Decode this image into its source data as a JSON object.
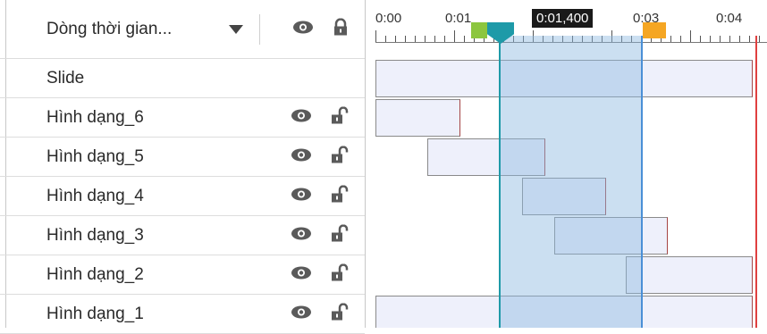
{
  "header": {
    "title": "Dòng thời gian...",
    "icons": [
      "eye-icon",
      "lock-closed-icon"
    ]
  },
  "rows": [
    {
      "label": "Slide",
      "visible_icon": "",
      "lock_icon": ""
    },
    {
      "label": "Hình dạng_6",
      "visible_icon": "eye-icon",
      "lock_icon": "lock-open-icon"
    },
    {
      "label": "Hình dạng_5",
      "visible_icon": "eye-icon",
      "lock_icon": "lock-open-icon"
    },
    {
      "label": "Hình dạng_4",
      "visible_icon": "eye-icon",
      "lock_icon": "lock-open-icon"
    },
    {
      "label": "Hình dạng_3",
      "visible_icon": "eye-icon",
      "lock_icon": "lock-open-icon"
    },
    {
      "label": "Hình dạng_2",
      "visible_icon": "eye-icon",
      "lock_icon": "lock-open-icon"
    },
    {
      "label": "Hình dạng_1",
      "visible_icon": "eye-icon",
      "lock_icon": "lock-open-icon"
    }
  ],
  "ruler": {
    "labels": [
      "0:00",
      "0:01",
      "0:03",
      "0:04"
    ],
    "playhead_time": "0:01,400"
  },
  "timeline": {
    "selection_start_s": 1.4,
    "selection_end_s": 2.9,
    "layers": [
      {
        "name": "Slide",
        "start_s": 0.0,
        "end_s": 4.0
      },
      {
        "name": "Hình dạng_6",
        "start_s": 0.0,
        "end_s": 0.9
      },
      {
        "name": "Hình dạng_5",
        "start_s": 0.55,
        "end_s": 1.8
      },
      {
        "name": "Hình dạng_4",
        "start_s": 1.55,
        "end_s": 2.45
      },
      {
        "name": "Hình dạng_3",
        "start_s": 1.9,
        "end_s": 3.1
      },
      {
        "name": "Hình dạng_2",
        "start_s": 2.65,
        "end_s": 4.0
      },
      {
        "name": "Hình dạng_1",
        "start_s": 0.0,
        "end_s": 4.0
      }
    ]
  },
  "colors": {
    "selection": "#8cb9e1",
    "playhead": "#1e9aa8",
    "start_marker": "#8cc63f",
    "end_marker": "#f5a623",
    "end_edge": "#e04040",
    "bar_fill": "#eef0fb"
  }
}
